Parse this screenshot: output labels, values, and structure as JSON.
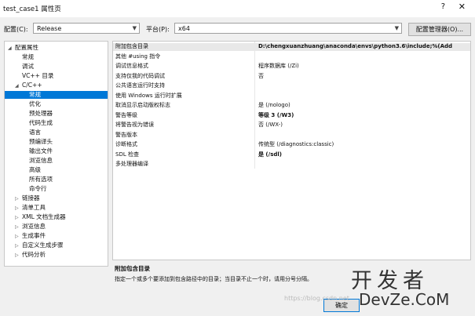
{
  "window": {
    "title": "test_case1 属性页",
    "help": "?",
    "close": "✕"
  },
  "toolbar": {
    "config_label": "配置(C):",
    "config_value": "Release",
    "platform_label": "平台(P):",
    "platform_value": "x64",
    "config_manager": "配置管理器(O)..."
  },
  "tree": [
    {
      "label": "配置属性",
      "toggle": "◢",
      "level": 0
    },
    {
      "label": "常规",
      "toggle": "",
      "level": 1
    },
    {
      "label": "调试",
      "toggle": "",
      "level": 1
    },
    {
      "label": "VC++ 目录",
      "toggle": "",
      "level": 1
    },
    {
      "label": "C/C++",
      "toggle": "◢",
      "level": 1
    },
    {
      "label": "常规",
      "toggle": "",
      "level": 2,
      "selected": true
    },
    {
      "label": "优化",
      "toggle": "",
      "level": 2
    },
    {
      "label": "预处理器",
      "toggle": "",
      "level": 2
    },
    {
      "label": "代码生成",
      "toggle": "",
      "level": 2
    },
    {
      "label": "语言",
      "toggle": "",
      "level": 2
    },
    {
      "label": "预编译头",
      "toggle": "",
      "level": 2
    },
    {
      "label": "输出文件",
      "toggle": "",
      "level": 2
    },
    {
      "label": "浏览信息",
      "toggle": "",
      "level": 2
    },
    {
      "label": "高级",
      "toggle": "",
      "level": 2
    },
    {
      "label": "所有选项",
      "toggle": "",
      "level": 2
    },
    {
      "label": "命令行",
      "toggle": "",
      "level": 2
    },
    {
      "label": "链接器",
      "toggle": "▷",
      "level": 1
    },
    {
      "label": "清单工具",
      "toggle": "▷",
      "level": 1
    },
    {
      "label": "XML 文档生成器",
      "toggle": "▷",
      "level": 1
    },
    {
      "label": "浏览信息",
      "toggle": "▷",
      "level": 1
    },
    {
      "label": "生成事件",
      "toggle": "▷",
      "level": 1
    },
    {
      "label": "自定义生成步骤",
      "toggle": "▷",
      "level": 1
    },
    {
      "label": "代码分析",
      "toggle": "▷",
      "level": 1
    }
  ],
  "properties": [
    {
      "name": "附加包含目录",
      "value": "D:\\chengxuanzhuang\\anaconda\\envs\\python3.6\\include;%(Add",
      "bold": true,
      "selected": true
    },
    {
      "name": "其他 #using 指令",
      "value": ""
    },
    {
      "name": "调试信息格式",
      "value": "程序数据库 (/Zi)"
    },
    {
      "name": "支持仅我的代码调试",
      "value": "否"
    },
    {
      "name": "公共语言运行时支持",
      "value": ""
    },
    {
      "name": "使用 Windows 运行时扩展",
      "value": ""
    },
    {
      "name": "取消显示启动版权标志",
      "value": "是 (/nologo)"
    },
    {
      "name": "警告等级",
      "value": "等级 3 (/W3)",
      "bold": true
    },
    {
      "name": "将警告视为错误",
      "value": "否 (/WX-)"
    },
    {
      "name": "警告版本",
      "value": ""
    },
    {
      "name": "诊断格式",
      "value": "传统型 (/diagnostics:classic)"
    },
    {
      "name": "SDL 检查",
      "value": "是 (/sdl)",
      "bold": true
    },
    {
      "name": "多处理器编译",
      "value": ""
    }
  ],
  "description": {
    "title": "附加包含目录",
    "text": "指定一个或多个要添加到包含路径中的目录；当目录不止一个时，请用分号分隔。"
  },
  "buttons": {
    "ok": "确定"
  },
  "watermark": {
    "url": "https://blog.csdn.net",
    "brand_top": "开发者",
    "brand_bottom": "DevZe.CoM"
  }
}
